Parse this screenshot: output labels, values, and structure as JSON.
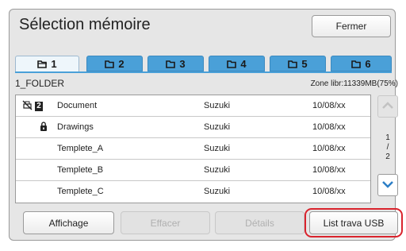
{
  "header": {
    "title": "Sélection mémoire",
    "close_label": "Fermer"
  },
  "tabs": [
    {
      "label": "1",
      "active": true
    },
    {
      "label": "2",
      "active": false
    },
    {
      "label": "3",
      "active": false
    },
    {
      "label": "4",
      "active": false
    },
    {
      "label": "5",
      "active": false
    },
    {
      "label": "6",
      "active": false
    }
  ],
  "folder": {
    "name": "1_FOLDER",
    "free_space": "Zone libr:11339MB(75%)"
  },
  "files": [
    {
      "name": "Document",
      "owner": "Suzuki",
      "date": "10/08/xx",
      "icons": [
        "no-print-icon",
        "number-badge-icon"
      ],
      "badge": "2"
    },
    {
      "name": "Drawings",
      "owner": "Suzuki",
      "date": "10/08/xx",
      "icons": [
        "lock-icon"
      ]
    },
    {
      "name": "Templete_A",
      "owner": "Suzuki",
      "date": "10/08/xx",
      "icons": []
    },
    {
      "name": "Templete_B",
      "owner": "Suzuki",
      "date": "10/08/xx",
      "icons": []
    },
    {
      "name": "Templete_C",
      "owner": "Suzuki",
      "date": "10/08/xx",
      "icons": []
    }
  ],
  "pagination": {
    "current": "1",
    "separator": "/",
    "total": "2"
  },
  "actions": {
    "display": "Affichage",
    "erase": "Effacer",
    "details": "Détails",
    "usb_job_list": "List trava USB"
  },
  "colors": {
    "tab_active": "#eef6fb",
    "tab_inactive": "#4aa0d8",
    "highlight": "#d9232d",
    "scroll_arrow": "#2d7fc6"
  }
}
